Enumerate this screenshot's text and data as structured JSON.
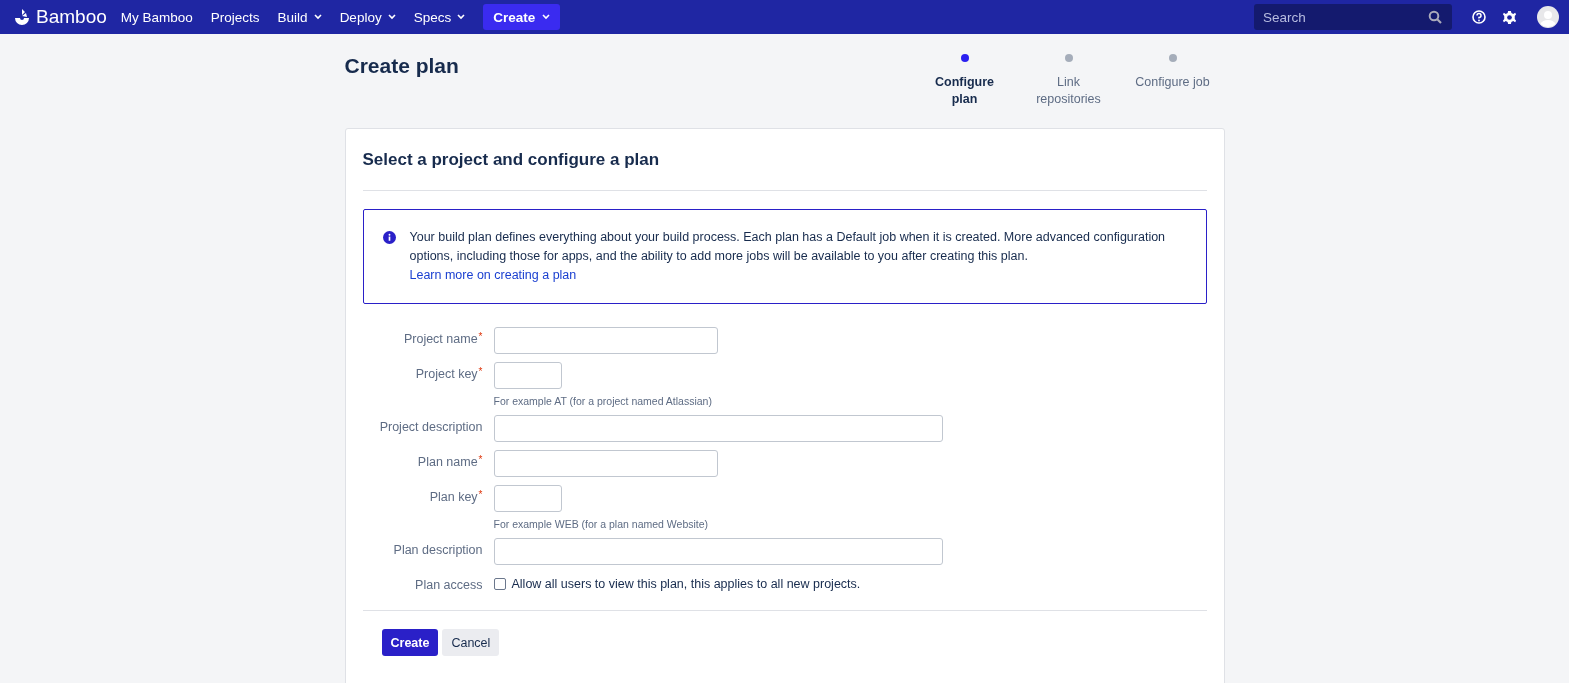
{
  "nav": {
    "logo": "Bamboo",
    "items": [
      {
        "label": "My Bamboo",
        "dropdown": false
      },
      {
        "label": "Projects",
        "dropdown": false
      },
      {
        "label": "Build",
        "dropdown": true
      },
      {
        "label": "Deploy",
        "dropdown": true
      },
      {
        "label": "Specs",
        "dropdown": true
      }
    ],
    "create": {
      "label": "Create",
      "dropdown": true
    },
    "search": {
      "placeholder": "Search"
    }
  },
  "page_title": "Create plan",
  "steps": [
    {
      "label": "Configure plan",
      "selected": true
    },
    {
      "label": "Link repositories",
      "selected": false
    },
    {
      "label": "Configure job",
      "selected": false
    }
  ],
  "card": {
    "title": "Select a project and configure a plan",
    "info": {
      "text": "Your build plan defines everything about your build process. Each plan has a Default job when it is created. More advanced configuration options, including those for apps, and the ability to add more jobs will be available to you after creating this plan.",
      "link": "Learn more on creating a plan"
    },
    "fields": [
      {
        "kind": "medium",
        "label": "Project name",
        "required_mark": "*"
      },
      {
        "kind": "short",
        "label": "Project key",
        "required_mark": "*",
        "hint": "For example AT (for a project named Atlassian)"
      },
      {
        "kind": "long",
        "label": "Project description"
      },
      {
        "kind": "medium",
        "label": "Plan name",
        "required_mark": "*"
      },
      {
        "kind": "short",
        "label": "Plan key",
        "required_mark": "*",
        "hint": "For example WEB (for a plan named Website)"
      },
      {
        "kind": "long",
        "label": "Plan description"
      },
      {
        "kind": "checkbox",
        "label": "Plan access",
        "option": "Allow all users to view this plan, this applies to all new projects.",
        "checked": false
      }
    ],
    "buttons": [
      {
        "label": "Create",
        "kind": "primary"
      },
      {
        "label": "Cancel",
        "kind": "secondary"
      }
    ]
  }
}
